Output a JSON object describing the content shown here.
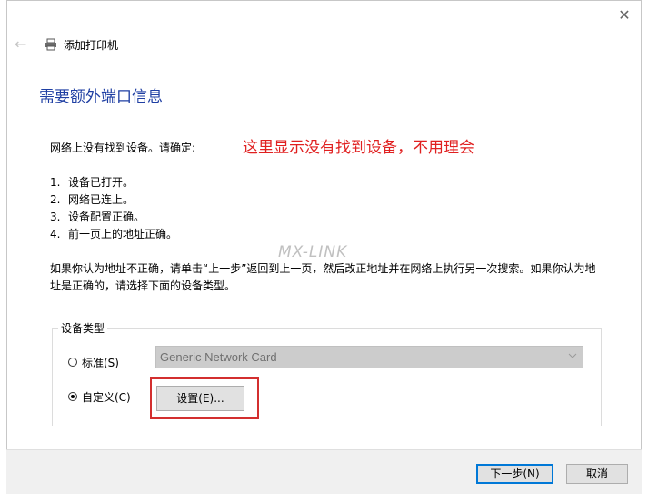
{
  "window": {
    "title": "添加打印机",
    "close_glyph": "✕",
    "back_glyph": "←"
  },
  "heading": "需要额外端口信息",
  "intro": "网络上没有找到设备。请确定:",
  "annotation": "这里显示没有找到设备，不用理会",
  "checklist": [
    {
      "num": "1.",
      "text": "设备已打开。"
    },
    {
      "num": "2.",
      "text": "网络已连上。"
    },
    {
      "num": "3.",
      "text": "设备配置正确。"
    },
    {
      "num": "4.",
      "text": "前一页上的地址正确。"
    }
  ],
  "watermark": "MX-LINK",
  "paragraph": "如果你认为地址不正确，请单击“上一步”返回到上一页，然后改正地址并在网络上执行另一次搜索。如果你认为地址是正确的，请选择下面的设备类型。",
  "device_type": {
    "legend": "设备类型",
    "standard_label": "标准(S)",
    "standard_value": "Generic Network Card",
    "custom_label": "自定义(C)",
    "setup_button": "设置(E)...",
    "selected": "custom"
  },
  "footer": {
    "next_label": "下一步(N)",
    "cancel_label": "取消"
  },
  "colors": {
    "heading": "#1f3fa3",
    "annotation": "#e02020",
    "highlight_box": "#d32f2f",
    "default_button_border": "#0078d7"
  },
  "icons": [
    "back-arrow-icon",
    "printer-icon",
    "close-icon",
    "chevron-down-icon"
  ]
}
